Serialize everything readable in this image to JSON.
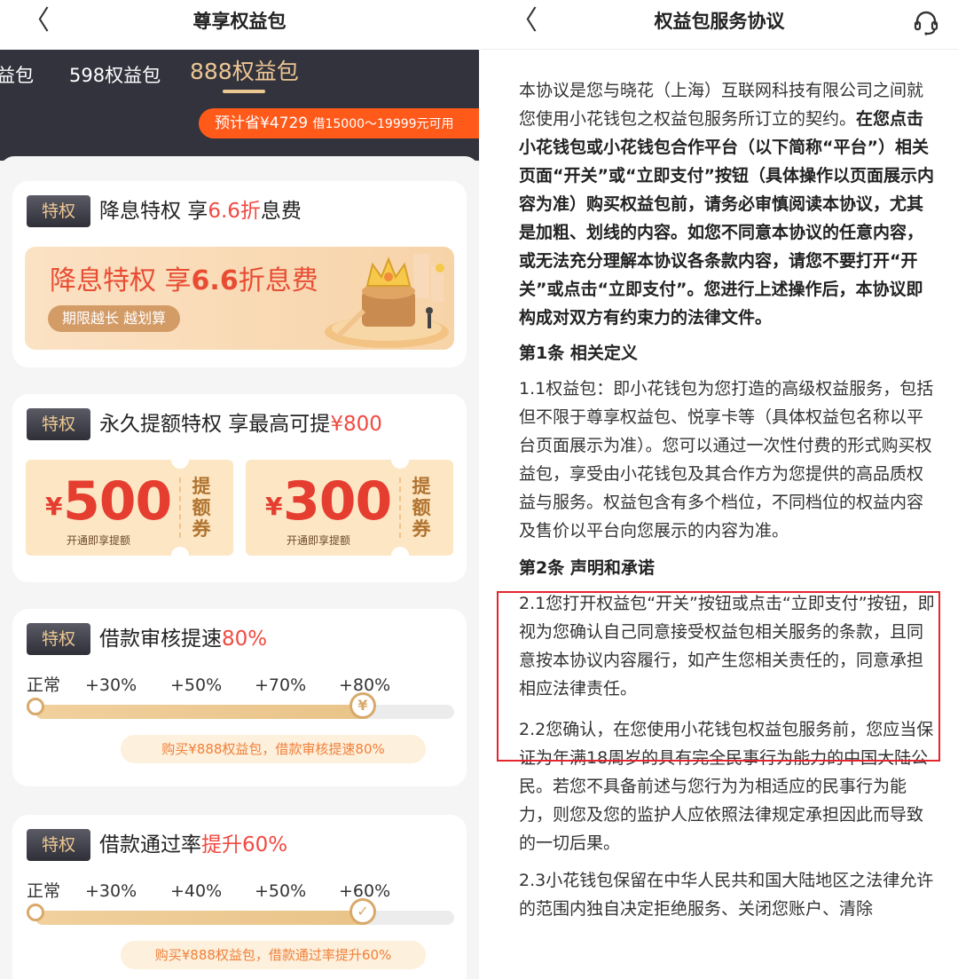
{
  "left": {
    "nav_title": "尊享权益包",
    "back_glyph": "〈",
    "tabs": [
      {
        "label": "益包"
      },
      {
        "label": "598权益包"
      },
      {
        "label": "888权益包",
        "active": true
      }
    ],
    "save_pill": {
      "main": "预计省¥4729 ",
      "small": "借15000～19999元可用"
    },
    "badge": "特权",
    "cards": {
      "interest": {
        "title_pre": "降息特权 享",
        "title_red": "6.6折",
        "title_post": "息费",
        "banner_pre": "降息特权 享",
        "banner_bold": "6.6",
        "banner_post": "折息费",
        "banner_sub": "期限越长 越划算"
      },
      "quota": {
        "title_pre": "永久提额特权 享最高可提",
        "title_red": "¥800",
        "coupons": [
          {
            "yen": "¥",
            "amount": "500",
            "sub": "开通即享提额",
            "vertical": "提额券"
          },
          {
            "yen": "¥",
            "amount": "300",
            "sub": "开通即享提额",
            "vertical": "提额券"
          }
        ]
      },
      "review": {
        "title_pre": "借款审核提速",
        "title_red": "80%",
        "steps": [
          "正常",
          "+30%",
          "+50%",
          "+70%",
          "+80%"
        ],
        "progress": 0.8,
        "end_glyph": "¥",
        "note": "购买¥888权益包，借款审核提速80%"
      },
      "pass": {
        "title_pre": "借款通过率",
        "title_red": "提升60%",
        "steps": [
          "正常",
          "+30%",
          "+40%",
          "+50%",
          "+60%"
        ],
        "progress": 0.8,
        "end_glyph": "✓",
        "note": "购买¥888权益包，借款通过率提升60%"
      }
    }
  },
  "right": {
    "nav_title": "权益包服务协议",
    "back_glyph": "〈",
    "intro_plain": "本协议是您与晓花（上海）互联网科技有限公司之间就您使用小花钱包之权益包服务所订立的契约。",
    "intro_bold": "在您点击小花钱包或小花钱包合作平台（以下简称“平台”）相关页面“开关”或“立即支付”按钮（具体操作以页面展示内容为准）购买权益包前，请务必审慎阅读本协议，尤其是加粗、划线的内容。如您不同意本协议的任意内容，或无法充分理解本协议各条款内容，请您不要打开“开关”或点击“立即支付”。您进行上述操作后，本协议即构成对双方有约束力的法律文件。",
    "art1_heading": "第1条 相关定义",
    "art1_p1": "1.1权益包：即小花钱包为您打造的高级权益服务，包括但不限于尊享权益包、悦享卡等（具体权益包名称以平台页面展示为准）。您可以通过一次性付费的形式购买权益包，享受由小花钱包及其合作方为您提供的高品质权益与服务。权益包含有多个档位，不同档位的权益内容及售价以平台向您展示的内容为准。",
    "art2_heading": "第2条 声明和承诺",
    "art2_p1": "2.1您打开权益包“开关”按钮或点击“立即支付”按钮，即视为您确认自己同意接受权益包相关服务的条款，且同意按本协议内容履行，如产生您相关责任的，同意承担相应法律责任。",
    "art2_p2": "2.2您确认，在您使用小花钱包权益包服务前，您应当保证为年满18周岁的具有完全民事行为能力的中国大陆公民。若您不具备前述与您行为为相适应的民事行为能力，则您及您的监护人应依照法律规定承担因此而导致的一切后果。",
    "art2_p3": "2.3小花钱包保留在中华人民共和国大陆地区之法律允许的范围内独自决定拒绝服务、关闭您账户、清除"
  }
}
